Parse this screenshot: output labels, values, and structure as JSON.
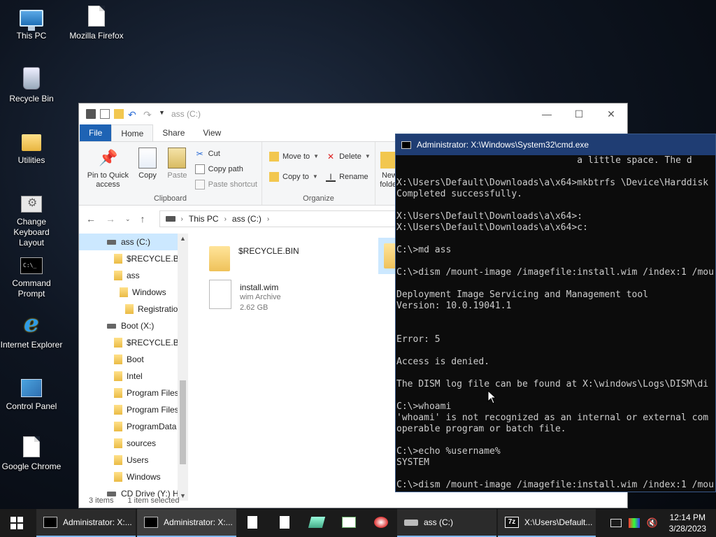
{
  "desktop": {
    "icons": [
      {
        "label": "This PC"
      },
      {
        "label": "Mozilla Firefox"
      },
      {
        "label": "Recycle Bin"
      },
      {
        "label": "Utilities"
      },
      {
        "label": "Change Keyboard Layout"
      },
      {
        "label": "Command Prompt"
      },
      {
        "label": "Internet Explorer"
      },
      {
        "label": "Control Panel"
      },
      {
        "label": "Google Chrome"
      }
    ]
  },
  "explorer": {
    "title": "ass (C:)",
    "tabs": {
      "file": "File",
      "home": "Home",
      "share": "Share",
      "view": "View"
    },
    "ribbon": {
      "pin": "Pin to Quick access",
      "copy": "Copy",
      "paste": "Paste",
      "cut": "Cut",
      "copy_path": "Copy path",
      "paste_shortcut": "Paste shortcut",
      "clipboard": "Clipboard",
      "move_to": "Move to",
      "copy_to": "Copy to",
      "delete": "Delete",
      "rename": "Rename",
      "organize": "Organize",
      "new_folder": "New folder"
    },
    "address": {
      "this_pc": "This PC",
      "current": "ass (C:)"
    },
    "nav": [
      "ass (C:)",
      "$RECYCLE.BIN",
      "ass",
      "Windows",
      "Registration",
      "Boot (X:)",
      "$RECYCLE.BIN",
      "Boot",
      "Intel",
      "Program Files",
      "Program Files (x86)",
      "ProgramData",
      "sources",
      "Users",
      "Windows",
      "CD Drive (Y:) H"
    ],
    "files": [
      {
        "name": "$RECYCLE.BIN",
        "type": "",
        "size": ""
      },
      {
        "name": "install.wim",
        "type": "wim Archive",
        "size": "2.62 GB"
      }
    ],
    "status": {
      "items": "3 items",
      "selected": "1 item selected"
    }
  },
  "cmd": {
    "title": "Administrator: X:\\Windows\\System32\\cmd.exe",
    "lines": [
      "                                 a little space. The d",
      "",
      "X:\\Users\\Default\\Downloads\\a\\x64>mkbtrfs \\Device\\Harddisk",
      "Completed successfully.",
      "",
      "X:\\Users\\Default\\Downloads\\a\\x64>:",
      "X:\\Users\\Default\\Downloads\\a\\x64>c:",
      "",
      "C:\\>md ass",
      "",
      "C:\\>dism /mount-image /imagefile:install.wim /index:1 /mou",
      "",
      "Deployment Image Servicing and Management tool",
      "Version: 10.0.19041.1",
      "",
      "",
      "Error: 5",
      "",
      "Access is denied.",
      "",
      "The DISM log file can be found at X:\\windows\\Logs\\DISM\\di",
      "",
      "C:\\>whoami",
      "'whoami' is not recognized as an internal or external com",
      "operable program or batch file.",
      "",
      "C:\\>echo %username%",
      "SYSTEM",
      "",
      "C:\\>dism /mount-image /imagefile:install.wim /index:1 /mou"
    ]
  },
  "taskbar": {
    "items": [
      {
        "label": "Administrator: X:..."
      },
      {
        "label": "Administrator: X:..."
      },
      {
        "label": "ass (C:)"
      },
      {
        "label": "X:\\Users\\Default..."
      }
    ],
    "time": "12:14 PM",
    "date": "3/28/2023"
  }
}
